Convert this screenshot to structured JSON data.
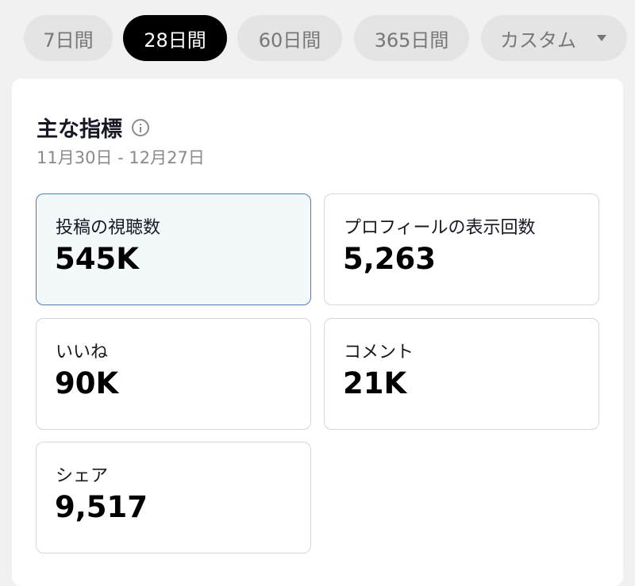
{
  "range_tabs": [
    {
      "label": "7日間",
      "active": false
    },
    {
      "label": "28日間",
      "active": true
    },
    {
      "label": "60日間",
      "active": false
    },
    {
      "label": "365日間",
      "active": false
    },
    {
      "label": "カスタム",
      "active": false,
      "icon": "caret-down-icon"
    }
  ],
  "card": {
    "title": "主な指標",
    "info_icon": "info-icon",
    "date_range": "11月30日 - 12月27日",
    "metrics": [
      {
        "label": "投稿の視聴数",
        "value": "545K",
        "selected": true
      },
      {
        "label": "プロフィールの表示回数",
        "value": "5,263",
        "selected": false
      },
      {
        "label": "いいね",
        "value": "90K",
        "selected": false
      },
      {
        "label": "コメント",
        "value": "21K",
        "selected": false
      },
      {
        "label": "シェア",
        "value": "9,517",
        "selected": false
      }
    ]
  },
  "colors": {
    "page_bg": "#f1f1f1",
    "active_tab_bg": "#000000",
    "inactive_tab_bg": "#e4e4e4",
    "selected_tile_bg": "#f3f8fb",
    "selected_tile_border": "#4a7fbd"
  }
}
